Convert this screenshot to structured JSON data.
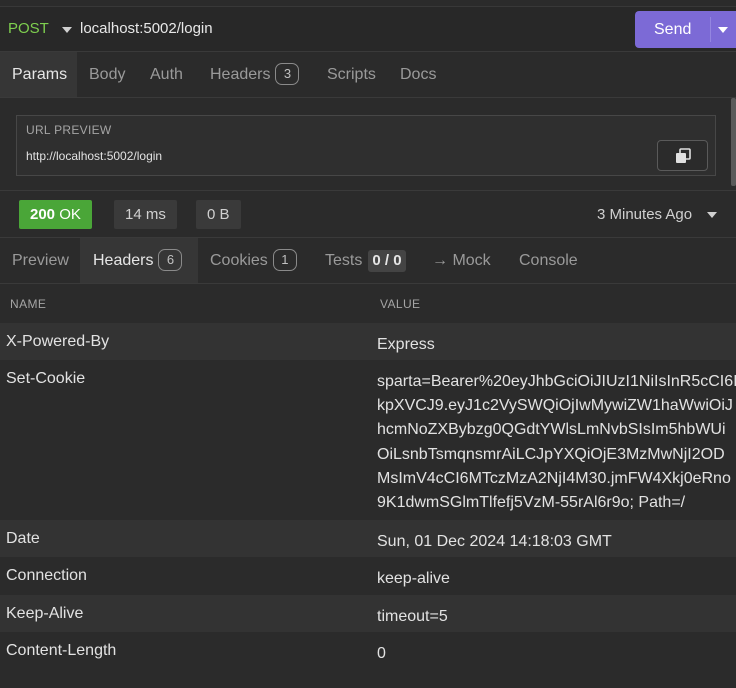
{
  "request": {
    "method": "POST",
    "url": "localhost:5002/login",
    "send_label": "Send"
  },
  "request_tabs": [
    {
      "label": "Params"
    },
    {
      "label": "Body"
    },
    {
      "label": "Auth"
    },
    {
      "label": "Headers",
      "badge": "3"
    },
    {
      "label": "Scripts"
    },
    {
      "label": "Docs"
    }
  ],
  "url_preview": {
    "title": "URL PREVIEW",
    "url": "http://localhost:5002/login"
  },
  "status": {
    "code": "200",
    "text": "OK",
    "time": "14 ms",
    "size": "0 B",
    "ago": "3 Minutes Ago"
  },
  "response_tabs": [
    {
      "label": "Preview"
    },
    {
      "label": "Headers",
      "badge": "6"
    },
    {
      "label": "Cookies",
      "badge": "1"
    },
    {
      "label": "Tests",
      "count": "0 / 0"
    },
    {
      "label": "→ Mock"
    },
    {
      "label": "Console"
    }
  ],
  "headers_table": {
    "columns": [
      "NAME",
      "VALUE"
    ],
    "rows": [
      {
        "name": "X-Powered-By",
        "value": "Express"
      },
      {
        "name": "Set-Cookie",
        "value_lines": [
          "sparta=Bearer%20eyJhbGciOiJIUzI1NiIsInR5cCI6I",
          "kpXVCJ9.eyJ1c2VySWQiOjIwMywiZW1haWwiOiJ",
          "hcmNoZXBybzg0QGdtYWlsLmNvbSIsIm5hbWUi",
          "OiLsnbTsmqnsmrAiLCJpYXQiOjE3MzMwNjI2OD",
          "MsImV4cCI6MTczMzA2NjI4M30.jmFW4Xkj0eRno",
          "9K1dwmSGlmTlfefj5VzM-55rAl6r9o; Path=/"
        ]
      },
      {
        "name": "Date",
        "value": "Sun, 01 Dec 2024 14:18:03 GMT"
      },
      {
        "name": "Connection",
        "value": "keep-alive"
      },
      {
        "name": "Keep-Alive",
        "value": "timeout=5"
      },
      {
        "name": "Content-Length",
        "value": "0"
      }
    ]
  },
  "colors": {
    "accent": "#7c6ad6",
    "method": "#7ecf4f",
    "status_ok": "#4aa638",
    "background": "#2b2b2b"
  }
}
